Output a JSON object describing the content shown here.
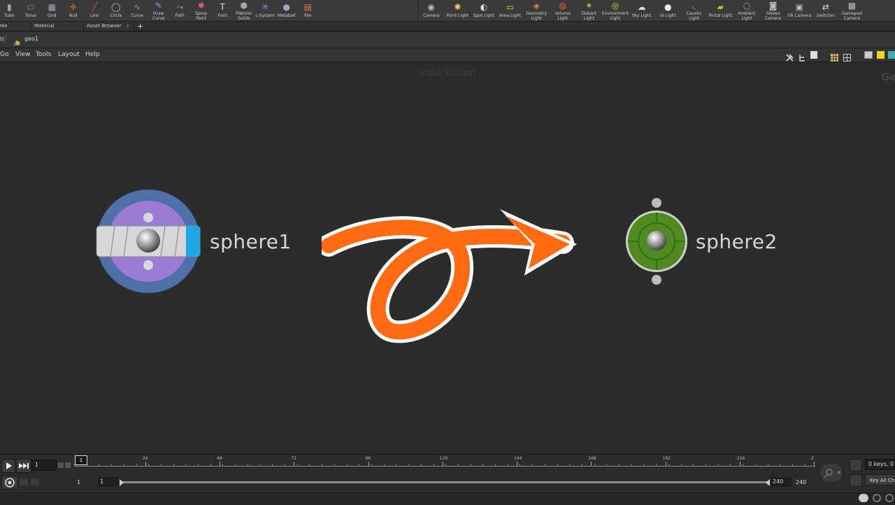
{
  "shelf": {
    "left_tools": [
      {
        "label": "Tube",
        "icon": "tube-icon"
      },
      {
        "label": "Torus",
        "icon": "torus-icon"
      },
      {
        "label": "Grid",
        "icon": "grid-icon"
      },
      {
        "label": "Null",
        "icon": "null-icon"
      },
      {
        "label": "Line",
        "icon": "line-icon"
      },
      {
        "label": "Circle",
        "icon": "circle-icon"
      },
      {
        "label": "Curve",
        "icon": "curve-icon"
      },
      {
        "label": "Draw Curve",
        "icon": "draw-curve-icon"
      },
      {
        "label": "Path",
        "icon": "path-icon"
      },
      {
        "label": "Spray Paint",
        "icon": "spray-paint-icon"
      },
      {
        "label": "Font",
        "icon": "font-icon"
      },
      {
        "label": "Platonic Solids",
        "icon": "platonic-solids-icon"
      },
      {
        "label": "L-System",
        "icon": "l-system-icon"
      },
      {
        "label": "Metaball",
        "icon": "metaball-icon"
      },
      {
        "label": "File",
        "icon": "file-icon"
      }
    ],
    "right_tools": [
      {
        "label": "Camera",
        "icon": "camera-icon"
      },
      {
        "label": "Point Light",
        "icon": "point-light-icon"
      },
      {
        "label": "Spot Light",
        "icon": "spot-light-icon"
      },
      {
        "label": "Area Light",
        "icon": "area-light-icon"
      },
      {
        "label": "Geometry Light",
        "icon": "geometry-light-icon"
      },
      {
        "label": "Volume Light",
        "icon": "volume-light-icon"
      },
      {
        "label": "Distant Light",
        "icon": "distant-light-icon"
      },
      {
        "label": "Environment Light",
        "icon": "environment-light-icon"
      },
      {
        "label": "Sky Light",
        "icon": "sky-light-icon"
      },
      {
        "label": "GI Light",
        "icon": "gi-light-icon"
      },
      {
        "label": "Caustic Light",
        "icon": "caustic-light-icon"
      },
      {
        "label": "Portal Light",
        "icon": "portal-light-icon"
      },
      {
        "label": "Ambient Light",
        "icon": "ambient-light-icon"
      },
      {
        "label": "Stereo Camera",
        "icon": "stereo-camera-icon"
      },
      {
        "label": "VR Camera",
        "icon": "vr-camera-icon"
      },
      {
        "label": "Switcher",
        "icon": "switcher-icon"
      },
      {
        "label": "Gamepad Camera",
        "icon": "gamepad-camera-icon"
      }
    ]
  },
  "tabs": [
    {
      "label": "Tree View"
    },
    {
      "label": "Material Palette"
    },
    {
      "label": "Asset Browser"
    }
  ],
  "pathbar": {
    "obj": "obj",
    "current": "geo1"
  },
  "menus": [
    "Go",
    "View",
    "Tools",
    "Layout",
    "Help"
  ],
  "network": {
    "edition": "Indie Edition",
    "context_label": "Geo",
    "node1": "sphere1",
    "node2": "sphere2"
  },
  "colors": {
    "arrow": "#ff6a13",
    "node1_ring": "#4f6fa8",
    "node1_inner": "#9b7bd3",
    "node2_fill": "#4e8a1f",
    "accent_blue": "#1fa8e8"
  },
  "timeline": {
    "current_frame": "1",
    "ticks": [
      "24",
      "48",
      "72",
      "96",
      "120",
      "144",
      "168",
      "192",
      "216",
      "2"
    ],
    "start_frame": "1",
    "range_start": "1",
    "range_end": "240",
    "end_frame": "240",
    "keys_label": "0 keys, 0",
    "key_all_label": "Key All Ch"
  }
}
